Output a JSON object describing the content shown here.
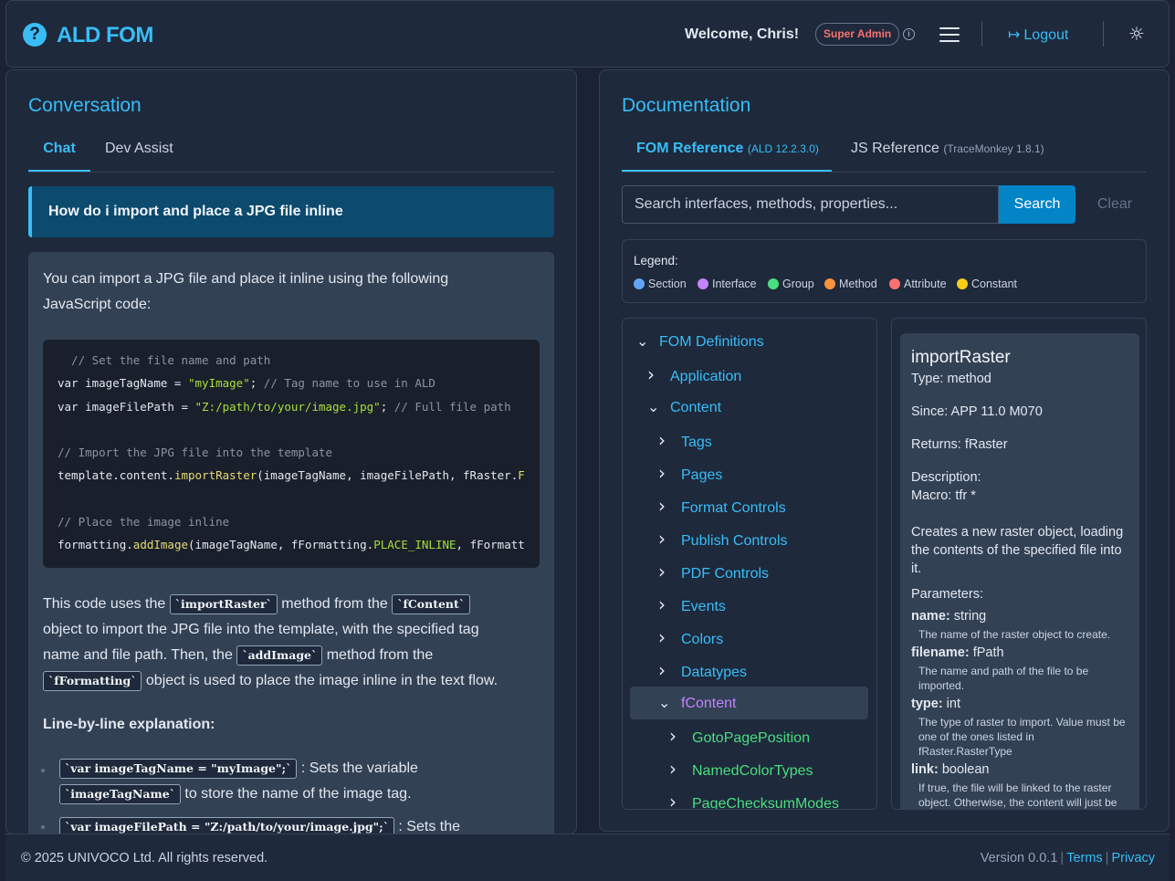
{
  "header": {
    "logo_glyph": "?",
    "app_title": "ALD FOM",
    "welcome": "Welcome, Chris!",
    "role": "Super Admin",
    "logout": "Logout"
  },
  "conversation": {
    "title": "Conversation",
    "tabs": [
      "Chat",
      "Dev Assist"
    ],
    "user_message": "How do i import and place a JPG file inline",
    "intro_line1": "You can import a JPG file and place it inline using the following",
    "intro_line2": "JavaScript code:",
    "code": {
      "c1": "  // Set the file name and path",
      "l2_kw": "var imageTagName = ",
      "l2_str": "\"myImage\"",
      "l2_rest": ";",
      "l2_cm": " // Tag name to use in ALD",
      "l3_kw": "var imageFilePath = ",
      "l3_str": "\"Z:/path/to/your/image.jpg\"",
      "l3_rest": ";",
      "l3_cm": " // Full file path",
      "c2": "// Import the JPG file into the template",
      "l5_a": "template.content.",
      "l5_fn": "importRaster",
      "l5_b": "(imageTagName, imageFilePath, fRaster.",
      "l5_c": "F",
      "c3": "// Place the image inline",
      "l7_a": "formatting.",
      "l7_fn": "addImage",
      "l7_b": "(imageTagName, fFormatting.",
      "l7_c": "PLACE_INLINE",
      "l7_d": ", fFormatt"
    },
    "p1": {
      "a": "This code uses the",
      "code1": "`importRaster`",
      "b": "method from the",
      "code2": "`fContent`",
      "line2": "object to import the JPG file into the template, with the specified tag",
      "c": "name and file path. Then, the",
      "code3": "`addImage`",
      "d": "method from the",
      "code4": "`fFormatting`",
      "e": "object is used to place the image inline in the text flow."
    },
    "explain_heading": "Line-by-line explanation:",
    "bullets": [
      {
        "code": "`var imageTagName = \"myImage\";`",
        "text": ": Sets the variable",
        "code2": "`imageTagName`",
        "text2": "to store the name of the image tag."
      },
      {
        "code": "`var imageFilePath = \"Z:/path/to/your/image.jpg\";`",
        "text": ": Sets the"
      }
    ]
  },
  "documentation": {
    "title": "Documentation",
    "tabs": [
      {
        "label": "FOM Reference",
        "sub": "(ALD 12.2.3.0)"
      },
      {
        "label": "JS Reference",
        "sub": "(TraceMonkey 1.8.1)"
      }
    ],
    "search_placeholder": "Search interfaces, methods, properties...",
    "search_button": "Search",
    "clear_button": "Clear",
    "legend_title": "Legend:",
    "legend": [
      {
        "label": "Section",
        "color": "#60a5fa"
      },
      {
        "label": "Interface",
        "color": "#c084fc"
      },
      {
        "label": "Group",
        "color": "#4ade80"
      },
      {
        "label": "Method",
        "color": "#fb923c"
      },
      {
        "label": "Attribute",
        "color": "#f87171"
      },
      {
        "label": "Constant",
        "color": "#facc15"
      }
    ],
    "tree": [
      {
        "label": "FOM Definitions",
        "expanded": true,
        "type": "section"
      },
      {
        "label": "Application",
        "expanded": false,
        "type": "section"
      },
      {
        "label": "Content",
        "expanded": true,
        "type": "section"
      },
      {
        "label": "Tags",
        "expanded": false,
        "type": "section"
      },
      {
        "label": "Pages",
        "expanded": false,
        "type": "section"
      },
      {
        "label": "Format Controls",
        "expanded": false,
        "type": "section"
      },
      {
        "label": "Publish Controls",
        "expanded": false,
        "type": "section"
      },
      {
        "label": "PDF Controls",
        "expanded": false,
        "type": "section"
      },
      {
        "label": "Events",
        "expanded": false,
        "type": "section"
      },
      {
        "label": "Colors",
        "expanded": false,
        "type": "section"
      },
      {
        "label": "Datatypes",
        "expanded": false,
        "type": "section"
      },
      {
        "label": "fContent",
        "expanded": true,
        "type": "interface",
        "selected": true
      },
      {
        "label": "GotoPagePosition",
        "expanded": false,
        "type": "group"
      },
      {
        "label": "NamedColorTypes",
        "expanded": false,
        "type": "group"
      },
      {
        "label": "PageChecksumModes",
        "expanded": false,
        "type": "group"
      }
    ],
    "detail": {
      "name": "importRaster",
      "type": "Type: method",
      "since": "Since: APP 11.0 M070",
      "returns": "Returns: fRaster",
      "description_label": "Description:",
      "macro": "Macro: tfr *",
      "desc_1": "Creates a new raster object, loading",
      "desc_2": "the contents of the specified file into",
      "desc_3": "it.",
      "params_label": "Parameters:",
      "params": [
        {
          "name": "name:",
          "type": " string",
          "desc": "The name of the raster object to create."
        },
        {
          "name": "filename:",
          "type": " fPath",
          "desc": "The name and path of the file to be imported."
        },
        {
          "name": "type:",
          "type": " int",
          "desc": "The type of raster to import. Value must be one of the ones listed in fRaster.RasterType"
        },
        {
          "name": "link:",
          "type": " boolean",
          "desc": "If true, the file will be linked to the raster object. Otherwise, the content will just be"
        }
      ]
    }
  },
  "footer": {
    "copyright": "© 2025 UNIVOCO Ltd. All rights reserved.",
    "version": "Version 0.0.1",
    "terms": "Terms",
    "privacy": "Privacy"
  }
}
